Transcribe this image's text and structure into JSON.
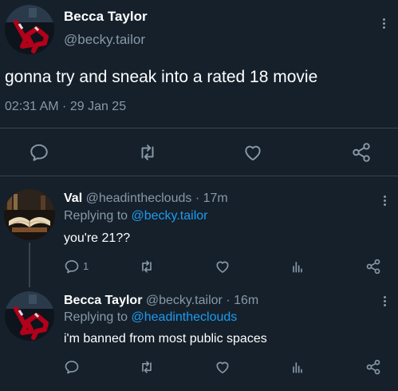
{
  "main_tweet": {
    "display_name": "Becca Taylor",
    "handle": "@becky.tailor",
    "text": "gonna try and sneak into a rated 18 movie",
    "timestamp": "02:31 AM · 29 Jan 25"
  },
  "replies": [
    {
      "display_name": "Val",
      "handle": "@headintheclouds",
      "age": "· 17m",
      "replying_prefix": "Replying to",
      "replying_to": "@becky.tailor",
      "text": "you're 21??",
      "reply_count": "1"
    },
    {
      "display_name": "Becca Taylor",
      "handle": "@becky.tailor",
      "age": "· 16m",
      "replying_prefix": "Replying to",
      "replying_to": "@headintheclouds",
      "text": "i'm banned from most public spaces",
      "reply_count": ""
    }
  ],
  "icons": {
    "reply": "reply-icon",
    "retweet": "retweet-icon",
    "like": "heart-icon",
    "stats": "stats-icon",
    "share": "share-icon",
    "more": "more-icon"
  },
  "colors": {
    "background": "#15202b",
    "text": "#ffffff",
    "muted": "#8899a6",
    "link": "#1d9bf0",
    "divider": "#38444d"
  }
}
